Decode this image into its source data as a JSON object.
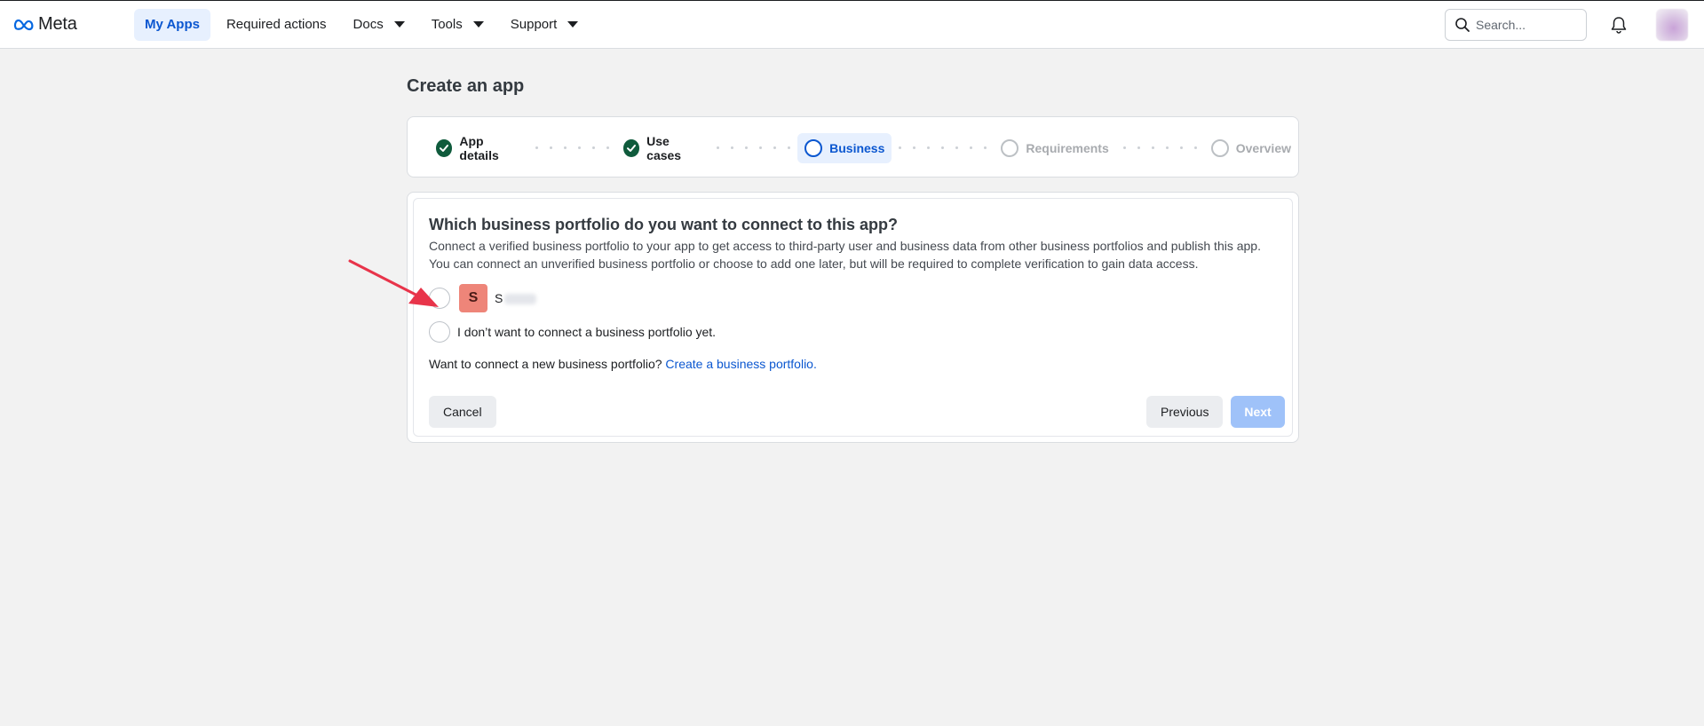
{
  "brand": {
    "name": "Meta"
  },
  "nav": {
    "items": [
      {
        "label": "My Apps",
        "active": true,
        "dropdown": false
      },
      {
        "label": "Required actions",
        "active": false,
        "dropdown": false
      },
      {
        "label": "Docs",
        "active": false,
        "dropdown": true
      },
      {
        "label": "Tools",
        "active": false,
        "dropdown": true
      },
      {
        "label": "Support",
        "active": false,
        "dropdown": true
      }
    ],
    "search_placeholder": "Search..."
  },
  "page": {
    "title": "Create an app"
  },
  "stepper": {
    "steps": [
      {
        "label": "App details",
        "state": "done"
      },
      {
        "label": "Use cases",
        "state": "done"
      },
      {
        "label": "Business",
        "state": "current"
      },
      {
        "label": "Requirements",
        "state": "todo"
      },
      {
        "label": "Overview",
        "state": "todo"
      }
    ]
  },
  "business": {
    "question": "Which business portfolio do you want to connect to this app?",
    "description_line1": "Connect a verified business portfolio to your app to get access to third-party user and business data from other business portfolios and publish this app.",
    "description_line2": "You can connect an unverified business portfolio or choose to add one later, but will be required to complete verification to gain data access.",
    "option_portfolio_initial": "S",
    "option_portfolio_name": "S",
    "option_none_label": "I don’t want to connect a business portfolio yet.",
    "connect_prompt": "Want to connect a new business portfolio?",
    "connect_link": "Create a business portfolio."
  },
  "actions": {
    "cancel": "Cancel",
    "previous": "Previous",
    "next": "Next"
  },
  "colors": {
    "accent": "#0b57d0",
    "done": "#0f5b3c",
    "badge": "#ee8579",
    "next_disabled": "#9fc2f9",
    "annotation_arrow": "#e8344a"
  }
}
